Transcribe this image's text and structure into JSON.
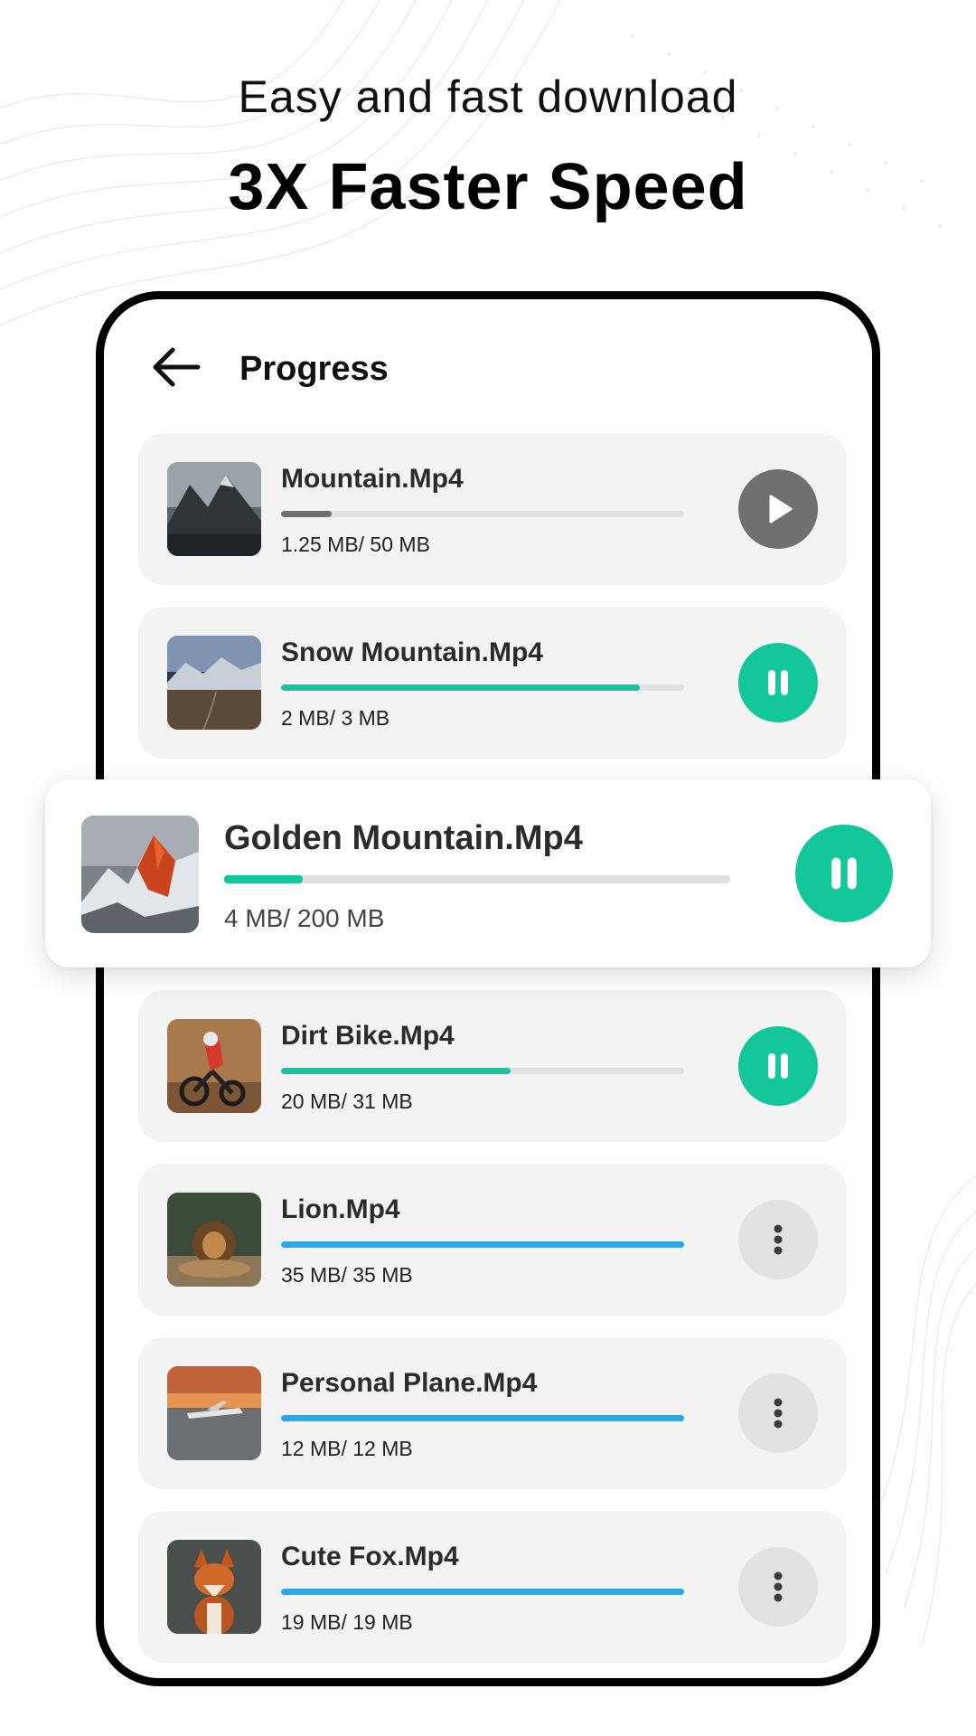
{
  "header": {
    "subtitle": "Easy and fast download",
    "title": "3X Faster Speed"
  },
  "screen": {
    "title": "Progress",
    "back_icon": "arrow-left-icon"
  },
  "colors": {
    "accent_green": "#14c79a",
    "progress_blue": "#23aaf2",
    "paused_gray": "#707070",
    "more_button_bg": "#e2e2e2"
  },
  "downloads": [
    {
      "name": "Mountain.Mp4",
      "size": "1.25 MB/ 50 MB",
      "progress": 0.125,
      "bar_color": "#707070",
      "action": "play-icon"
    },
    {
      "name": "Snow Mountain.Mp4",
      "size": "2 MB/ 3 MB",
      "progress": 0.89,
      "bar_color": "#14c79a",
      "action": "pause-icon"
    },
    {
      "name": "Dirt Bike.Mp4",
      "size": "20 MB/ 31 MB",
      "progress": 0.57,
      "bar_color": "#14c79a",
      "action": "pause-icon"
    },
    {
      "name": "Lion.Mp4",
      "size": "35 MB/ 35 MB",
      "progress": 1.0,
      "bar_color": "#23aaf2",
      "action": "more-vertical-icon"
    },
    {
      "name": "Personal Plane.Mp4",
      "size": "12 MB/ 12 MB",
      "progress": 1.0,
      "bar_color": "#23aaf2",
      "action": "more-vertical-icon"
    },
    {
      "name": "Cute Fox.Mp4",
      "size": "19 MB/ 19 MB",
      "progress": 1.0,
      "bar_color": "#23aaf2",
      "action": "more-vertical-icon"
    }
  ],
  "featured": {
    "name": "Golden Mountain.Mp4",
    "size": "4 MB/ 200 MB",
    "progress": 0.155,
    "bar_color": "#14c79a",
    "action": "pause-icon"
  }
}
